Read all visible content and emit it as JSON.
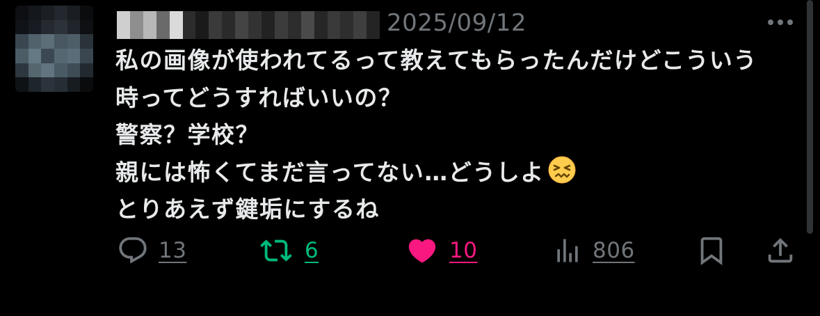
{
  "tweet": {
    "timestamp": "2025/09/12",
    "lines": [
      "私の画像が使われてるって教えてもらったんだけどこういう",
      "時ってどうすればいいの？",
      "警察？学校？",
      "親には怖くてまだ言ってない…どうしよ",
      "とりあえず鍵垢にするね"
    ],
    "emoji": "confounded-face"
  },
  "actions": {
    "reply_count": "13",
    "repost_count": "6",
    "like_count": "10",
    "views_count": "806",
    "like_liked": true
  },
  "colors": {
    "text": "#e7e9ea",
    "secondary": "#71767b",
    "repost": "#00ba7c",
    "like": "#f91880",
    "background": "#000000"
  },
  "icons": {
    "reply": "speech-bubble-icon",
    "repost": "repost-arrows-icon",
    "like": "heart-icon",
    "views": "bar-chart-icon",
    "bookmark": "bookmark-icon",
    "share": "share-upload-icon",
    "more": "more-dots-icon"
  }
}
